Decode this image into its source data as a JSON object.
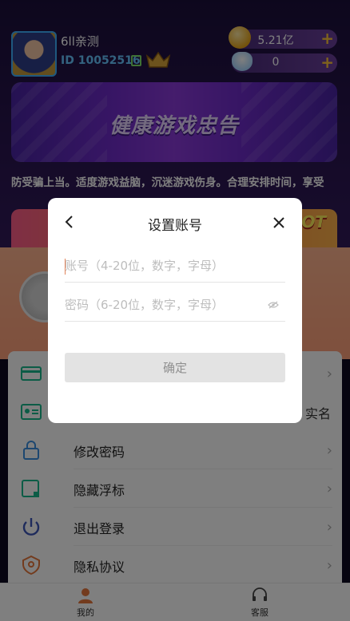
{
  "profile": {
    "nickname": "6ll亲测",
    "id_prefix": "ID",
    "id_value": "10052516",
    "coins": "5.21亿",
    "gems": "0",
    "add_symbol": "+"
  },
  "banner": {
    "title": "健康游戏忠告"
  },
  "marquee": "防受骗上当。适度游戏益脑，沉迷游戏伤身。合理安排时间，享受",
  "promo": {
    "hot_text": "HOT"
  },
  "menu": {
    "items": [
      {
        "label": "",
        "extra": "",
        "icon": "card-icon"
      },
      {
        "label": "",
        "extra": "实名",
        "icon": "id-card-icon"
      },
      {
        "label": "修改密码",
        "extra": "",
        "icon": "lock-icon"
      },
      {
        "label": "隐藏浮标",
        "extra": "",
        "icon": "float-icon"
      },
      {
        "label": "退出登录",
        "extra": "",
        "icon": "power-icon"
      },
      {
        "label": "隐私协议",
        "extra": "",
        "icon": "shield-icon"
      }
    ],
    "chevron": "›"
  },
  "tabbar": {
    "mine": "我的",
    "service": "客服"
  },
  "dialog": {
    "title": "设置账号",
    "account_placeholder": "账号（4-20位，数字，字母）",
    "password_placeholder": "密码（6-20位，数字，字母）",
    "confirm_label": "确定"
  },
  "colors": {
    "accent_orange": "#e2845b",
    "confirm_bg": "#e3e3e3"
  }
}
